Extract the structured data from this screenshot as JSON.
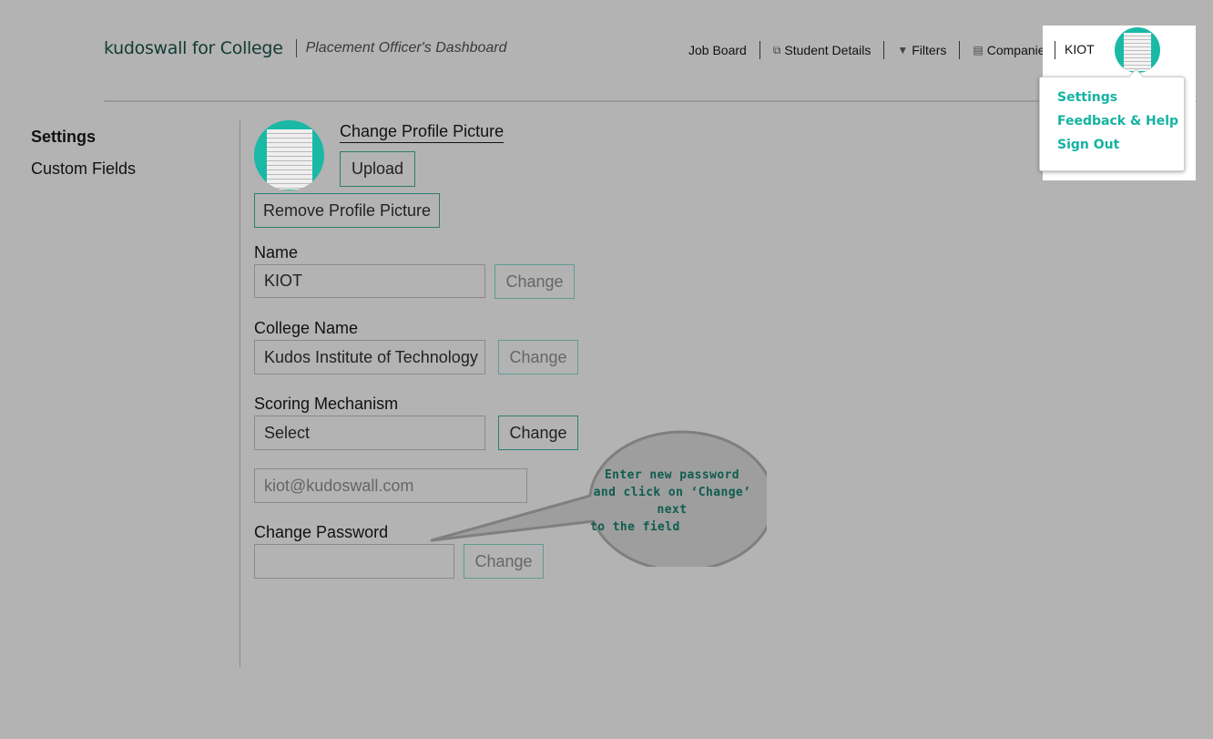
{
  "header": {
    "brand": "kudoswall for College",
    "subtitle": "Placement Officer's Dashboard",
    "nav": [
      {
        "label": "Job Board",
        "icon": ""
      },
      {
        "label": "Student Details",
        "icon": "copy-icon"
      },
      {
        "label": "Filters",
        "icon": "filter-icon"
      },
      {
        "label": "Companies",
        "icon": "building-icon"
      }
    ],
    "user_name": "KIOT"
  },
  "dropdown": {
    "items": [
      "Settings",
      "Feedback & Help",
      "Sign Out"
    ]
  },
  "sidebar": {
    "items": [
      "Settings",
      "Custom Fields"
    ]
  },
  "profile": {
    "change_picture_label": "Change Profile Picture",
    "upload_label": "Upload",
    "remove_label": "Remove Profile Picture"
  },
  "form": {
    "name_label": "Name",
    "name_value": "KIOT",
    "name_change": "Change",
    "college_label": "College Name",
    "college_value": "Kudos Institute of Technology",
    "college_change": "Change",
    "scoring_label": "Scoring Mechanism",
    "scoring_value": "Select",
    "scoring_change": "Change",
    "email_value": "kiot@kudoswall.com",
    "password_label": "Change Password",
    "password_value": "",
    "password_change": "Change"
  },
  "callout": {
    "line1": "Enter new password",
    "line2": "and click on ‘Change’ next",
    "line3": "to the field"
  },
  "colors": {
    "accent": "#15b3a2",
    "button_border": "#2f7d70",
    "background": "#b3b3b3"
  }
}
